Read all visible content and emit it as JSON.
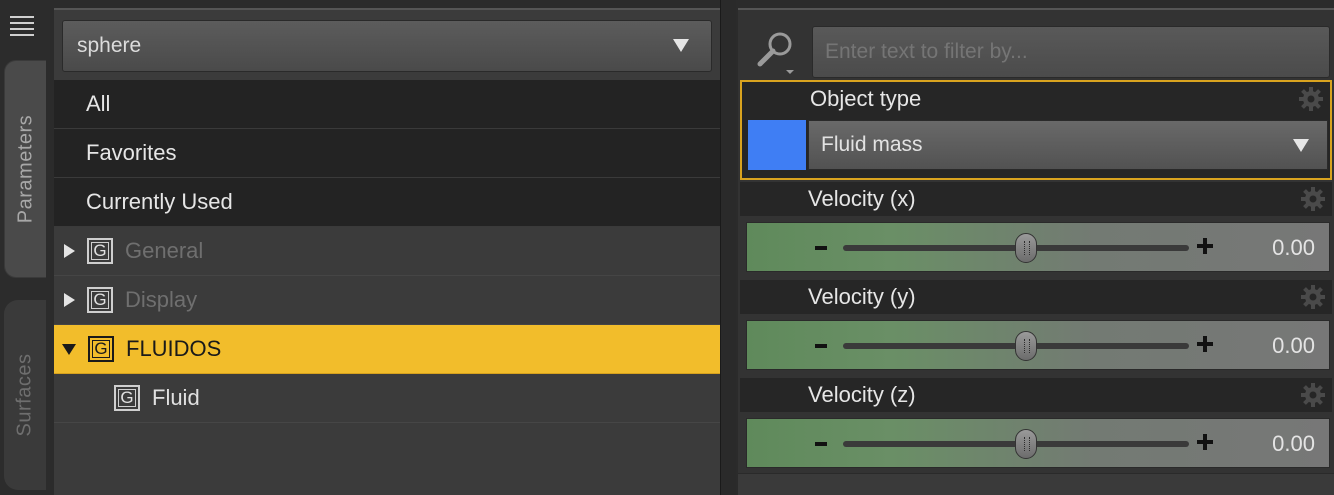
{
  "tabs": [
    {
      "label": "Parameters",
      "active": true
    },
    {
      "label": "Surfaces",
      "active": false
    }
  ],
  "node_selector": {
    "value": "sphere"
  },
  "tree": {
    "filters": [
      "All",
      "Favorites",
      "Currently Used"
    ],
    "groups": [
      {
        "label": "General",
        "expanded": false,
        "enabled": false,
        "badge": "G"
      },
      {
        "label": "Display",
        "expanded": false,
        "enabled": false,
        "badge": "G"
      },
      {
        "label": "FLUIDOS",
        "expanded": true,
        "selected": true,
        "badge": "G"
      },
      {
        "label": "Fluid",
        "child": true,
        "badge": "G"
      }
    ]
  },
  "filter": {
    "placeholder": "Enter text to filter by..."
  },
  "params": {
    "object_type": {
      "label": "Object type",
      "value": "Fluid mass",
      "swatch_color": "#3f7ef4"
    },
    "velocity_x": {
      "label": "Velocity (x)",
      "value": "0.00",
      "level": 0.5
    },
    "velocity_y": {
      "label": "Velocity (y)",
      "value": "0.00",
      "level": 0.5
    },
    "velocity_z": {
      "label": "Velocity (z)",
      "value": "0.00",
      "level": 0.5
    }
  },
  "colors": {
    "selection": "#f2bd2b",
    "highlight_border": "#d9a31f",
    "slider_green": "#6a8f66"
  },
  "icons": [
    "menu-icon",
    "search-icon",
    "gear-icon",
    "group-icon",
    "expand-arrow-icon",
    "collapse-arrow-icon",
    "dropdown-arrow-icon"
  ]
}
